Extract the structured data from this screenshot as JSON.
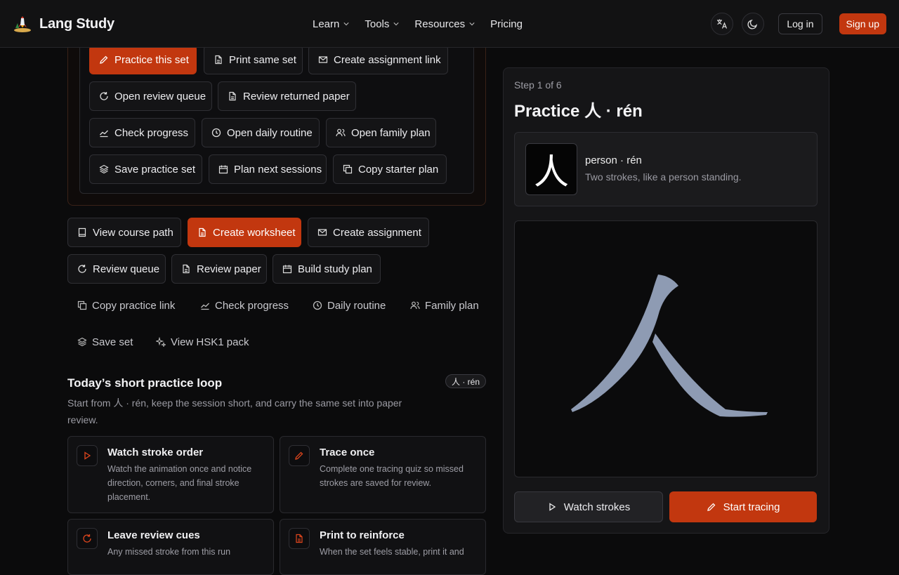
{
  "nav": {
    "brand": "Lang Study",
    "menu": [
      {
        "label": "Learn"
      },
      {
        "label": "Tools"
      },
      {
        "label": "Resources"
      },
      {
        "label": "Pricing"
      }
    ],
    "login": "Log in",
    "signup": "Sign up"
  },
  "top_actions": {
    "practice": "Practice this set",
    "print": "Print same set",
    "assignment_link": "Create assignment link",
    "review_queue": "Open review queue",
    "review_paper": "Review returned paper",
    "progress": "Check progress",
    "daily": "Open daily routine",
    "family": "Open family plan",
    "save": "Save practice set",
    "plan": "Plan next sessions",
    "copy": "Copy starter plan"
  },
  "actions": {
    "course": "View course path",
    "worksheet": "Create worksheet",
    "assignment": "Create assignment",
    "queue": "Review queue",
    "paper": "Review paper",
    "study_plan": "Build study plan",
    "copy_link": "Copy practice link",
    "progress": "Check progress",
    "daily": "Daily routine",
    "family": "Family plan",
    "save": "Save set",
    "hsk": "View HSK1 pack"
  },
  "loop": {
    "title": "Today’s short practice loop",
    "badge": "人 · rén",
    "desc": "Start from 人 · rén, keep the session short, and carry the same set into paper review.",
    "cards": [
      {
        "title": "Watch stroke order",
        "desc": "Watch the animation once and notice direction, corners, and final stroke placement.",
        "icon": "play-icon"
      },
      {
        "title": "Trace once",
        "desc": "Complete one tracing quiz so missed strokes are saved for review.",
        "icon": "pencil-icon"
      },
      {
        "title": "Leave review cues",
        "desc": "Any missed stroke from this run",
        "icon": "refresh-icon"
      },
      {
        "title": "Print to reinforce",
        "desc": "When the set feels stable, print it and",
        "icon": "document-icon"
      }
    ]
  },
  "practice": {
    "step": "Step 1 of 6",
    "title": "Practice 人 · rén",
    "char": "人",
    "name": "person · rén",
    "desc": "Two strokes, like a person standing.",
    "watch": "Watch strokes",
    "trace": "Start tracing"
  },
  "colors": {
    "accent": "#c2370f",
    "stroke": "#8e9bb3"
  }
}
